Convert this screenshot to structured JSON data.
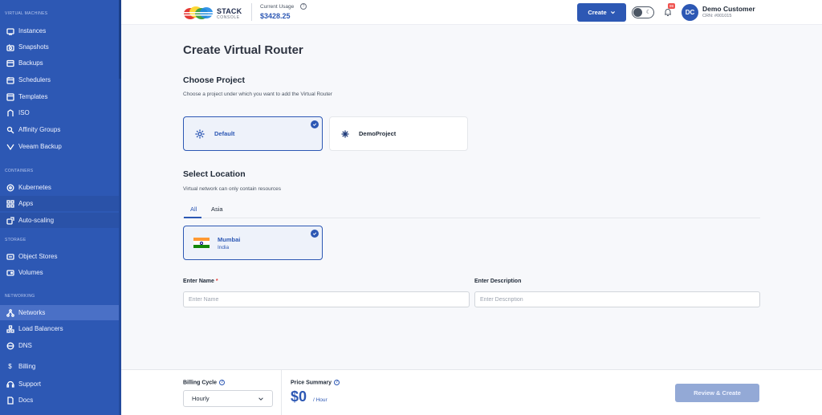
{
  "sidebar": {
    "sections": [
      {
        "label": "VIRTUAL MACHINES"
      },
      {
        "label": "CONTAINERS"
      },
      {
        "label": "STORAGE"
      },
      {
        "label": "NETWORKING"
      }
    ],
    "items": [
      {
        "label": "Instances",
        "icon": "instances-icon"
      },
      {
        "label": "Snapshots",
        "icon": "snapshots-icon"
      },
      {
        "label": "Backups",
        "icon": "backups-icon"
      },
      {
        "label": "Schedulers",
        "icon": "schedulers-icon"
      },
      {
        "label": "Templates",
        "icon": "templates-icon"
      },
      {
        "label": "ISO",
        "icon": "iso-icon"
      },
      {
        "label": "Affinity Groups",
        "icon": "affinity-icon"
      },
      {
        "label": "Veeam Backup",
        "icon": "veeam-icon"
      },
      {
        "label": "Kubernetes",
        "icon": "kubernetes-icon"
      },
      {
        "label": "Apps",
        "icon": "apps-icon"
      },
      {
        "label": "Auto-scaling",
        "icon": "autoscaling-icon"
      },
      {
        "label": "Object Stores",
        "icon": "object-store-icon"
      },
      {
        "label": "Volumes",
        "icon": "volumes-icon"
      },
      {
        "label": "Networks",
        "icon": "networks-icon"
      },
      {
        "label": "Load Balancers",
        "icon": "load-balancer-icon"
      },
      {
        "label": "DNS",
        "icon": "dns-icon"
      },
      {
        "label": "Billing",
        "icon": "billing-icon"
      },
      {
        "label": "Support",
        "icon": "support-icon"
      },
      {
        "label": "Docs",
        "icon": "docs-icon"
      }
    ],
    "active_item": "Networks"
  },
  "header": {
    "logo_text": "STACK",
    "logo_sub": "CONSOLE",
    "usage_label": "Current Usage",
    "usage_value": "$3428.25",
    "create_label": "Create",
    "notification_count": "99",
    "avatar_initials": "DC",
    "user_name": "Demo Customer",
    "user_crn": "CRN: #001015"
  },
  "main": {
    "title": "Create Virtual Router",
    "project": {
      "heading": "Choose Project",
      "description": "Choose a project under which you want to add the Virtual Router",
      "options": [
        {
          "label": "Default",
          "selected": true
        },
        {
          "label": "DemoProject",
          "selected": false
        }
      ]
    },
    "location": {
      "heading": "Select Location",
      "description": "Virtual network can only contain resources",
      "tabs": [
        {
          "label": "All",
          "active": true
        },
        {
          "label": "Asia",
          "active": false
        }
      ],
      "options": [
        {
          "city": "Mumbai",
          "country": "India",
          "selected": true
        }
      ]
    },
    "form": {
      "name_label": "Enter Name",
      "name_required": "*",
      "name_placeholder": "Enter Name",
      "description_label": "Enter Description",
      "description_placeholder": "Enter Description"
    }
  },
  "footer": {
    "billing_cycle_label": "Billing Cycle",
    "billing_cycle_value": "Hourly",
    "price_summary_label": "Price Summary",
    "price_value": "$0",
    "price_unit": "/ Hour",
    "review_label": "Review & Create"
  },
  "colors": {
    "brand": "#2d58b4",
    "sidebar_bg": "#2d58b4",
    "review_disabled": "#93a9d6",
    "badge": "#ef5350"
  }
}
